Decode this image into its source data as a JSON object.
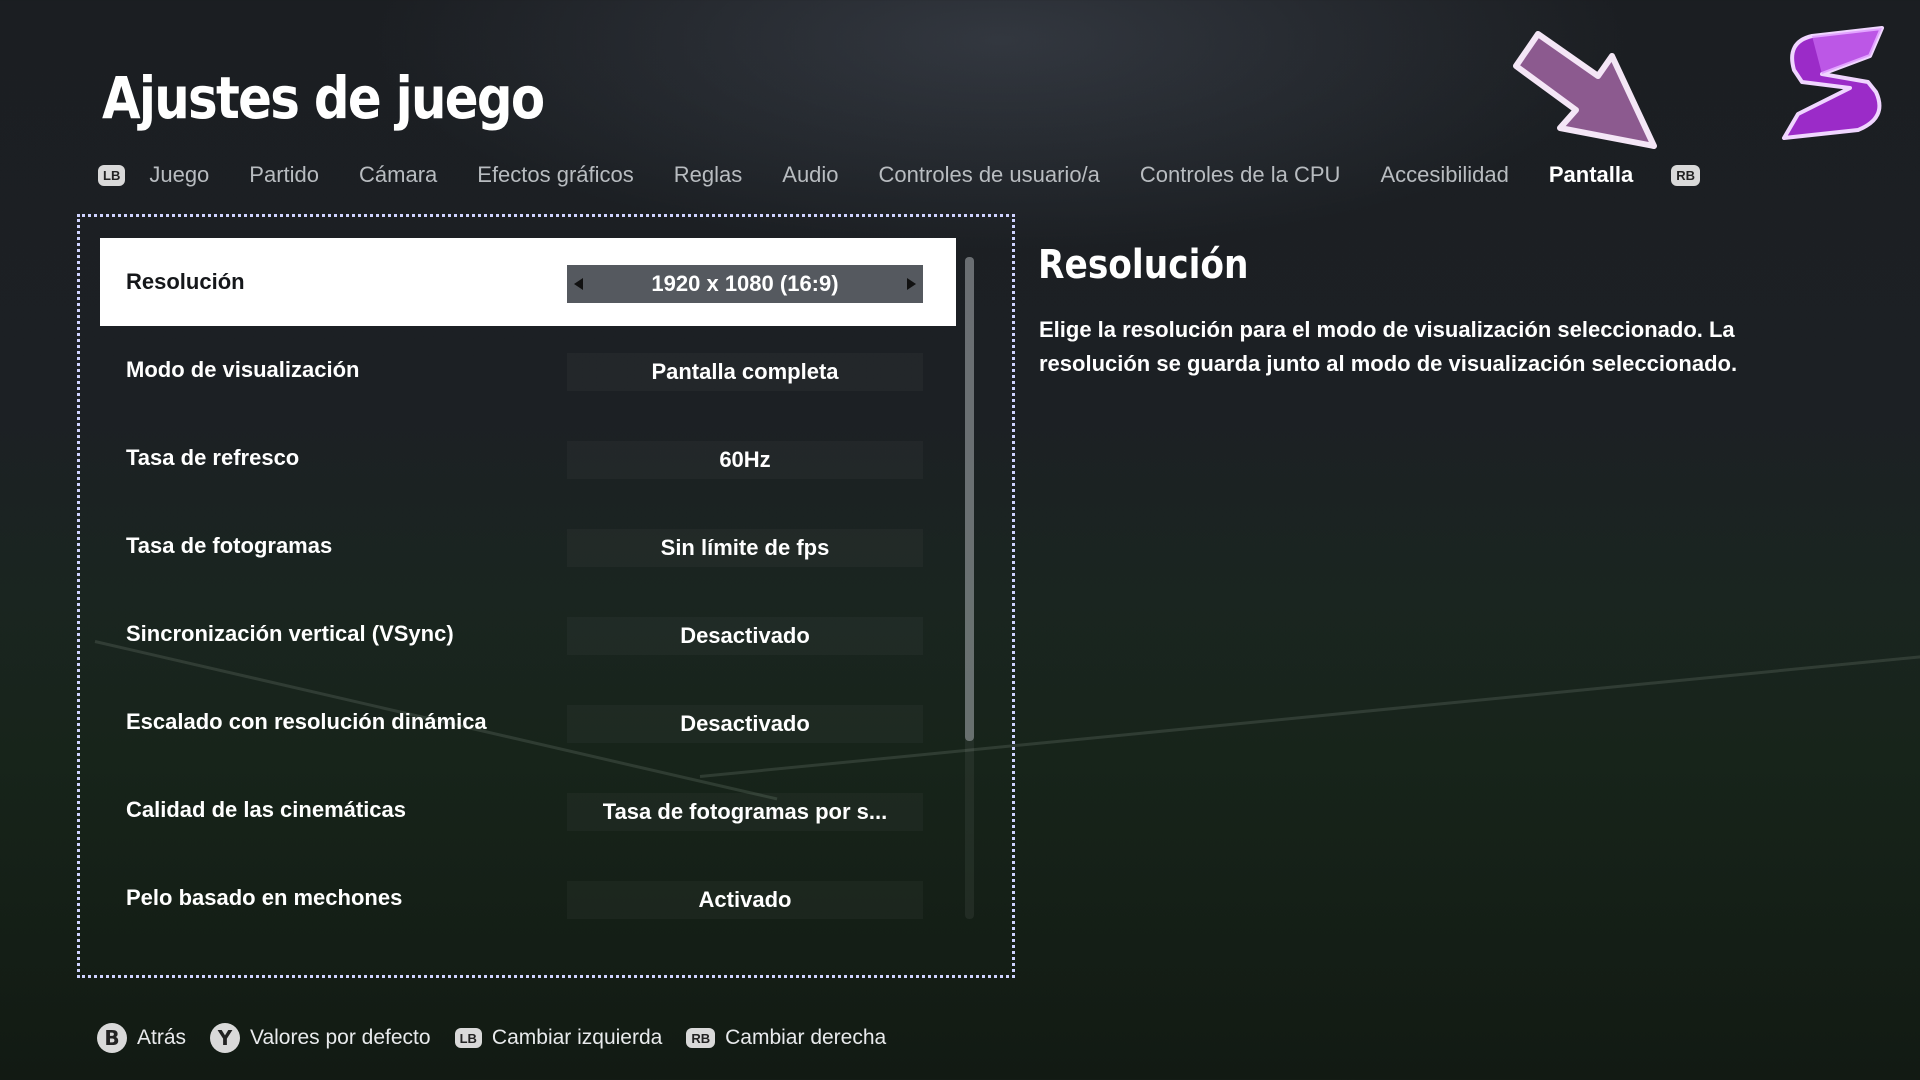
{
  "page": {
    "title": "Ajustes de juego"
  },
  "tabs": {
    "left_bumper": "LB",
    "right_bumper": "RB",
    "items": [
      {
        "label": "Juego"
      },
      {
        "label": "Partido"
      },
      {
        "label": "Cámara"
      },
      {
        "label": "Efectos gráficos"
      },
      {
        "label": "Reglas"
      },
      {
        "label": "Audio"
      },
      {
        "label": "Controles de usuario/a"
      },
      {
        "label": "Controles de la CPU"
      },
      {
        "label": "Accesibilidad"
      },
      {
        "label": "Pantalla",
        "active": true
      }
    ]
  },
  "settings": [
    {
      "label": "Resolución",
      "value": "1920 x 1080 (16:9)",
      "selected": true
    },
    {
      "label": "Modo de visualización",
      "value": "Pantalla completa"
    },
    {
      "label": "Tasa de refresco",
      "value": "60Hz"
    },
    {
      "label": "Tasa de fotogramas",
      "value": "Sin límite de fps"
    },
    {
      "label": "Sincronización vertical (VSync)",
      "value": "Desactivado"
    },
    {
      "label": "Escalado con resolución dinámica",
      "value": "Desactivado"
    },
    {
      "label": "Calidad de las cinemáticas",
      "value": "Tasa de fotogramas por s..."
    },
    {
      "label": "Pelo basado en mechones",
      "value": "Activado"
    }
  ],
  "detail": {
    "title": "Resolución",
    "description": "Elige la resolución para el modo de visualización seleccionado. La resolución se guarda junto al modo de visualización seleccionado."
  },
  "footer": {
    "back": {
      "button": "B",
      "label": "Atrás"
    },
    "defaults": {
      "button": "Y",
      "label": "Valores por defecto"
    },
    "left": {
      "button": "LB",
      "label": "Cambiar izquierda"
    },
    "right": {
      "button": "RB",
      "label": "Cambiar derecha"
    }
  },
  "colors": {
    "selected_row": "#ffffff",
    "selected_value": "#55595f",
    "panel_border": "#cfd3ff",
    "accent_purple": "#c05ad8"
  },
  "icons": {
    "pointer": "arrow-pointer-icon",
    "logo": "s-logo-icon"
  }
}
